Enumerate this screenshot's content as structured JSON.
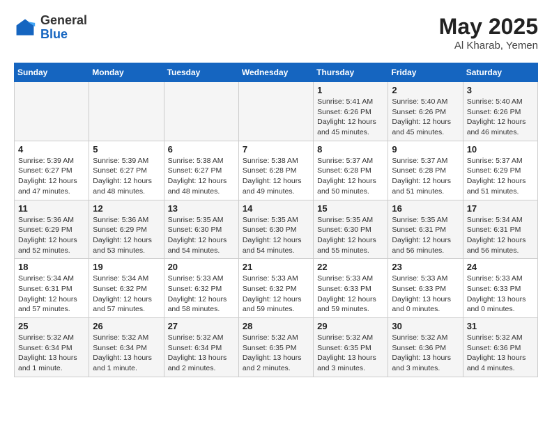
{
  "header": {
    "logo_general": "General",
    "logo_blue": "Blue",
    "month": "May 2025",
    "location": "Al Kharab, Yemen"
  },
  "weekdays": [
    "Sunday",
    "Monday",
    "Tuesday",
    "Wednesday",
    "Thursday",
    "Friday",
    "Saturday"
  ],
  "weeks": [
    [
      {
        "day": "",
        "info": ""
      },
      {
        "day": "",
        "info": ""
      },
      {
        "day": "",
        "info": ""
      },
      {
        "day": "",
        "info": ""
      },
      {
        "day": "1",
        "info": "Sunrise: 5:41 AM\nSunset: 6:26 PM\nDaylight: 12 hours\nand 45 minutes."
      },
      {
        "day": "2",
        "info": "Sunrise: 5:40 AM\nSunset: 6:26 PM\nDaylight: 12 hours\nand 45 minutes."
      },
      {
        "day": "3",
        "info": "Sunrise: 5:40 AM\nSunset: 6:26 PM\nDaylight: 12 hours\nand 46 minutes."
      }
    ],
    [
      {
        "day": "4",
        "info": "Sunrise: 5:39 AM\nSunset: 6:27 PM\nDaylight: 12 hours\nand 47 minutes."
      },
      {
        "day": "5",
        "info": "Sunrise: 5:39 AM\nSunset: 6:27 PM\nDaylight: 12 hours\nand 48 minutes."
      },
      {
        "day": "6",
        "info": "Sunrise: 5:38 AM\nSunset: 6:27 PM\nDaylight: 12 hours\nand 48 minutes."
      },
      {
        "day": "7",
        "info": "Sunrise: 5:38 AM\nSunset: 6:28 PM\nDaylight: 12 hours\nand 49 minutes."
      },
      {
        "day": "8",
        "info": "Sunrise: 5:37 AM\nSunset: 6:28 PM\nDaylight: 12 hours\nand 50 minutes."
      },
      {
        "day": "9",
        "info": "Sunrise: 5:37 AM\nSunset: 6:28 PM\nDaylight: 12 hours\nand 51 minutes."
      },
      {
        "day": "10",
        "info": "Sunrise: 5:37 AM\nSunset: 6:29 PM\nDaylight: 12 hours\nand 51 minutes."
      }
    ],
    [
      {
        "day": "11",
        "info": "Sunrise: 5:36 AM\nSunset: 6:29 PM\nDaylight: 12 hours\nand 52 minutes."
      },
      {
        "day": "12",
        "info": "Sunrise: 5:36 AM\nSunset: 6:29 PM\nDaylight: 12 hours\nand 53 minutes."
      },
      {
        "day": "13",
        "info": "Sunrise: 5:35 AM\nSunset: 6:30 PM\nDaylight: 12 hours\nand 54 minutes."
      },
      {
        "day": "14",
        "info": "Sunrise: 5:35 AM\nSunset: 6:30 PM\nDaylight: 12 hours\nand 54 minutes."
      },
      {
        "day": "15",
        "info": "Sunrise: 5:35 AM\nSunset: 6:30 PM\nDaylight: 12 hours\nand 55 minutes."
      },
      {
        "day": "16",
        "info": "Sunrise: 5:35 AM\nSunset: 6:31 PM\nDaylight: 12 hours\nand 56 minutes."
      },
      {
        "day": "17",
        "info": "Sunrise: 5:34 AM\nSunset: 6:31 PM\nDaylight: 12 hours\nand 56 minutes."
      }
    ],
    [
      {
        "day": "18",
        "info": "Sunrise: 5:34 AM\nSunset: 6:31 PM\nDaylight: 12 hours\nand 57 minutes."
      },
      {
        "day": "19",
        "info": "Sunrise: 5:34 AM\nSunset: 6:32 PM\nDaylight: 12 hours\nand 57 minutes."
      },
      {
        "day": "20",
        "info": "Sunrise: 5:33 AM\nSunset: 6:32 PM\nDaylight: 12 hours\nand 58 minutes."
      },
      {
        "day": "21",
        "info": "Sunrise: 5:33 AM\nSunset: 6:32 PM\nDaylight: 12 hours\nand 59 minutes."
      },
      {
        "day": "22",
        "info": "Sunrise: 5:33 AM\nSunset: 6:33 PM\nDaylight: 12 hours\nand 59 minutes."
      },
      {
        "day": "23",
        "info": "Sunrise: 5:33 AM\nSunset: 6:33 PM\nDaylight: 13 hours\nand 0 minutes."
      },
      {
        "day": "24",
        "info": "Sunrise: 5:33 AM\nSunset: 6:33 PM\nDaylight: 13 hours\nand 0 minutes."
      }
    ],
    [
      {
        "day": "25",
        "info": "Sunrise: 5:32 AM\nSunset: 6:34 PM\nDaylight: 13 hours\nand 1 minute."
      },
      {
        "day": "26",
        "info": "Sunrise: 5:32 AM\nSunset: 6:34 PM\nDaylight: 13 hours\nand 1 minute."
      },
      {
        "day": "27",
        "info": "Sunrise: 5:32 AM\nSunset: 6:34 PM\nDaylight: 13 hours\nand 2 minutes."
      },
      {
        "day": "28",
        "info": "Sunrise: 5:32 AM\nSunset: 6:35 PM\nDaylight: 13 hours\nand 2 minutes."
      },
      {
        "day": "29",
        "info": "Sunrise: 5:32 AM\nSunset: 6:35 PM\nDaylight: 13 hours\nand 3 minutes."
      },
      {
        "day": "30",
        "info": "Sunrise: 5:32 AM\nSunset: 6:36 PM\nDaylight: 13 hours\nand 3 minutes."
      },
      {
        "day": "31",
        "info": "Sunrise: 5:32 AM\nSunset: 6:36 PM\nDaylight: 13 hours\nand 4 minutes."
      }
    ]
  ]
}
